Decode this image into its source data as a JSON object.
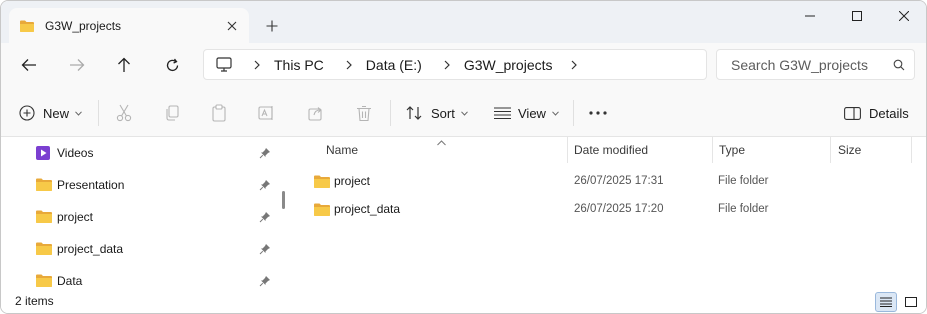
{
  "tab": {
    "title": "G3W_projects",
    "icon": "folder-icon"
  },
  "window": {
    "new_tab_icon": "plus-icon",
    "minimize_icon": "minimize-icon",
    "maximize_icon": "maximize-icon",
    "close_icon": "close-icon"
  },
  "address": {
    "crumbs": [
      "This PC",
      "Data (E:)",
      "G3W_projects"
    ],
    "root_icon": "computer-icon",
    "search_placeholder": "Search G3W_projects"
  },
  "toolbar": {
    "new_label": "New",
    "sort_label": "Sort",
    "view_label": "View",
    "details_label": "Details"
  },
  "navpane": {
    "items": [
      {
        "label": "Videos",
        "icon": "videos-folder-icon"
      },
      {
        "label": "Presentation",
        "icon": "folder-icon"
      },
      {
        "label": "project",
        "icon": "folder-icon"
      },
      {
        "label": "project_data",
        "icon": "folder-icon"
      },
      {
        "label": "Data",
        "icon": "folder-icon"
      }
    ]
  },
  "filelist": {
    "columns": [
      "Name",
      "Date modified",
      "Type",
      "Size"
    ],
    "rows": [
      {
        "name": "project",
        "date": "26/07/2025 17:31",
        "type": "File folder",
        "size": ""
      },
      {
        "name": "project_data",
        "date": "26/07/2025 17:20",
        "type": "File folder",
        "size": ""
      }
    ]
  },
  "status": {
    "count": "2 items"
  },
  "colors": {
    "folder": "#f7c948",
    "folder_dark": "#e8a93a",
    "accent": "#0067c0",
    "videos": "#7b3fd1"
  }
}
